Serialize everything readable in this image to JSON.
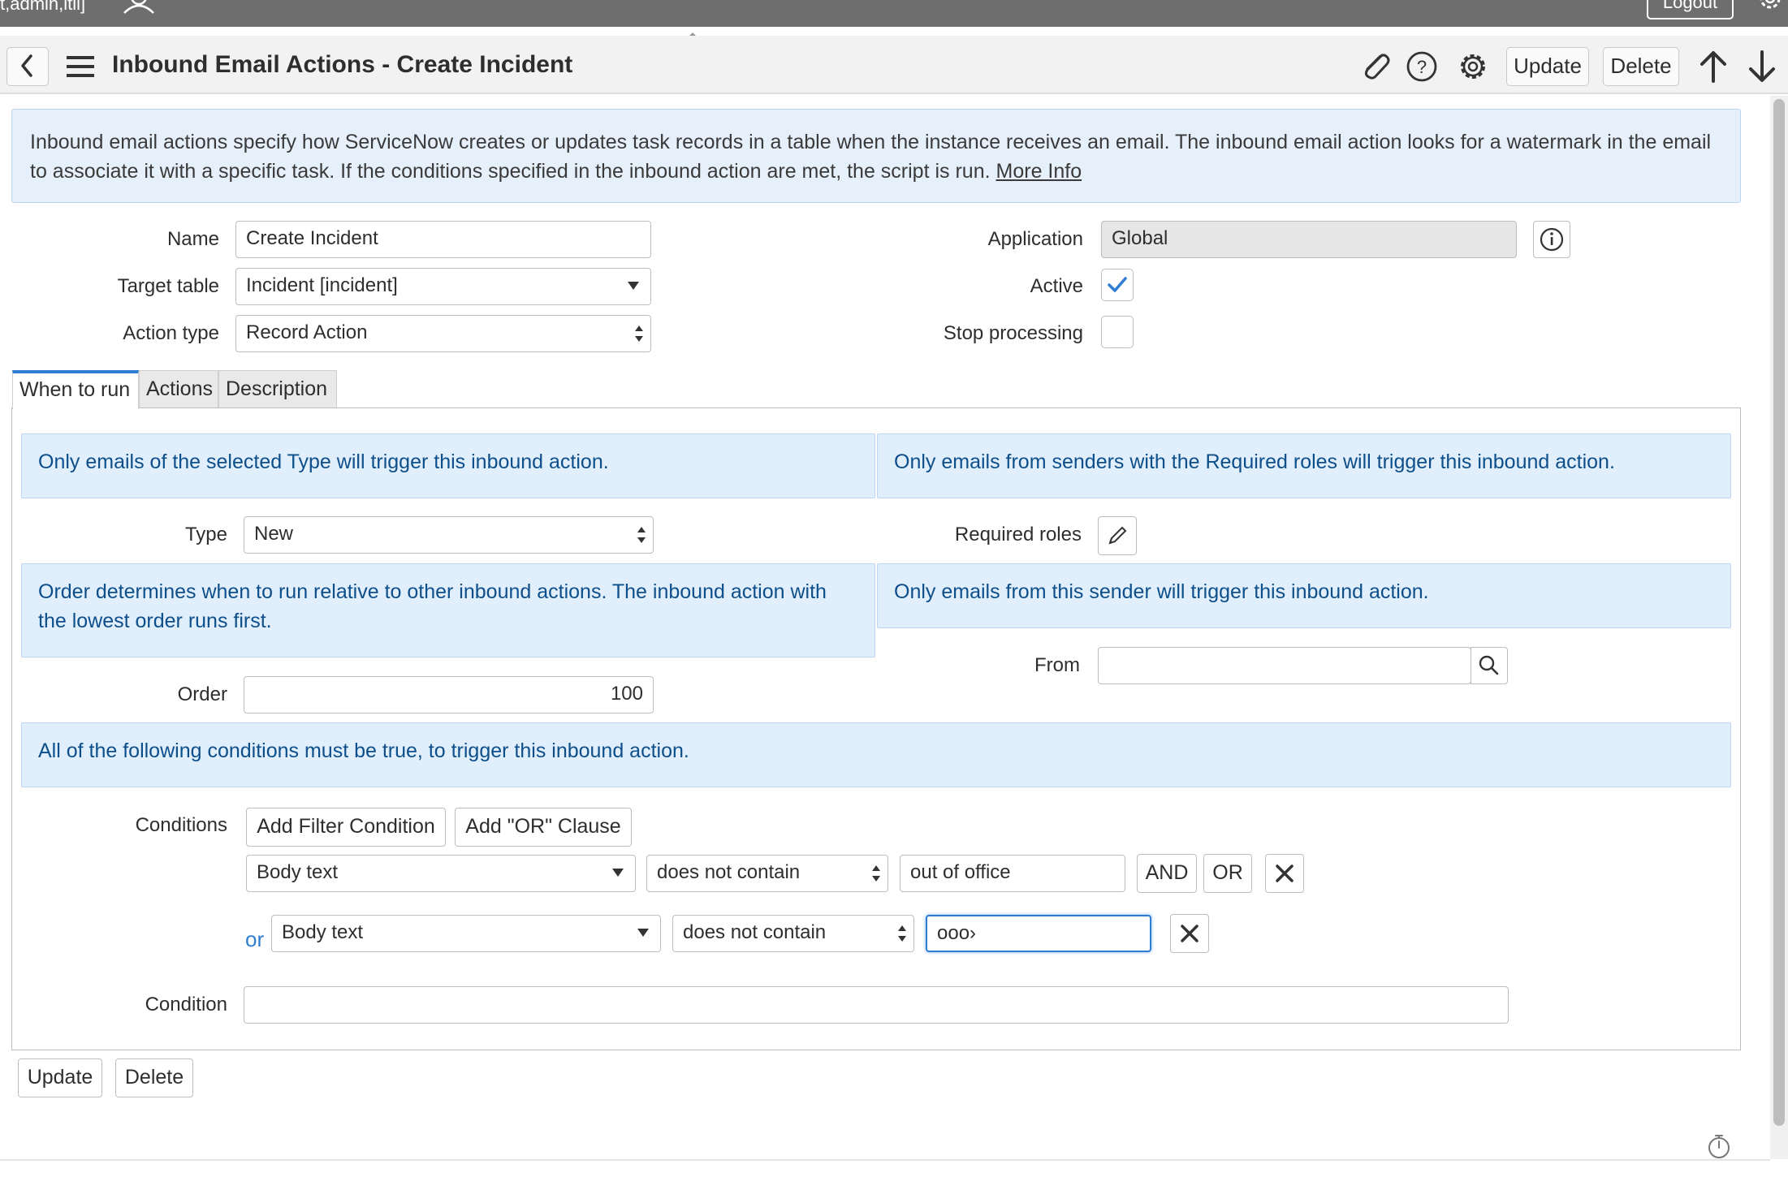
{
  "topbar": {
    "user_roles": "t,admin,itil]",
    "logout_label": "Logout"
  },
  "header": {
    "title": "Inbound Email Actions - Create Incident",
    "update_label": "Update",
    "delete_label": "Delete"
  },
  "info_banner": {
    "text": "Inbound email actions specify how ServiceNow creates or updates task records in a table when the instance receives an email. The inbound email action looks for a watermark in the email to associate it with a specific task. If the conditions specified in the inbound action are met, the script is run. ",
    "link": "More Info"
  },
  "form": {
    "name_label": "Name",
    "name_value": "Create Incident",
    "target_table_label": "Target table",
    "target_table_value": "Incident [incident]",
    "action_type_label": "Action type",
    "action_type_value": "Record Action",
    "application_label": "Application",
    "application_value": "Global",
    "active_label": "Active",
    "active_checked": true,
    "stop_processing_label": "Stop processing",
    "stop_processing_checked": false
  },
  "tabs": [
    {
      "label": "When to run",
      "active": true
    },
    {
      "label": "Actions",
      "active": false
    },
    {
      "label": "Description",
      "active": false
    }
  ],
  "when_to_run": {
    "type_help": "Only emails of the selected Type will trigger this inbound action.",
    "roles_help": "Only emails from senders with the Required roles will trigger this inbound action.",
    "type_label": "Type",
    "type_value": "New",
    "required_roles_label": "Required roles",
    "order_help": "Order determines when to run relative to other inbound actions. The inbound action with the lowest order runs first.",
    "from_help": "Only emails from this sender will trigger this inbound action.",
    "order_label": "Order",
    "order_value": "100",
    "from_label": "From",
    "from_value": "",
    "conditions_help": "All of the following conditions must be true, to trigger this inbound action.",
    "conditions_label": "Conditions",
    "add_filter_label": "Add Filter Condition",
    "add_or_label": "Add \"OR\" Clause",
    "condition_rows": [
      {
        "prefix": "",
        "field": "Body text",
        "operator": "does not contain",
        "value": "out of office"
      },
      {
        "prefix": "or",
        "field": "Body text",
        "operator": "does not contain",
        "value": "ooo›"
      }
    ],
    "and_label": "AND",
    "or_label": "OR",
    "condition_label": "Condition",
    "condition_value": ""
  },
  "footer": {
    "update_label": "Update",
    "delete_label": "Delete"
  },
  "colors": {
    "accent": "#2f7dd3",
    "help_text": "#0d4f8b",
    "help_bg": "#e1eefb",
    "topbar": "#6e6e6e"
  }
}
